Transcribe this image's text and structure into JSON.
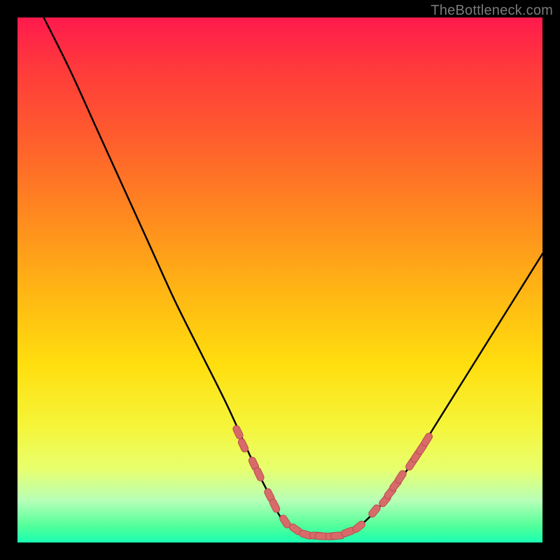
{
  "watermark": "TheBottleneck.com",
  "colors": {
    "background": "#000000",
    "gradient_top": "#ff1a4d",
    "gradient_bottom": "#19ffb2",
    "curve": "#000000",
    "marker_fill": "#d86a6a",
    "marker_stroke": "#b84f4f"
  },
  "chart_data": {
    "type": "line",
    "title": "",
    "xlabel": "",
    "ylabel": "",
    "xlim": [
      0,
      100
    ],
    "ylim": [
      0,
      100
    ],
    "series": [
      {
        "name": "curve",
        "x": [
          5,
          10,
          15,
          20,
          25,
          30,
          35,
          40,
          45,
          48,
          50,
          52,
          55,
          58,
          60,
          62,
          65,
          70,
          75,
          80,
          85,
          90,
          95,
          100
        ],
        "y": [
          100,
          90,
          79,
          68,
          57,
          46,
          36,
          26,
          15,
          9,
          5,
          3,
          1.5,
          1.2,
          1.2,
          1.5,
          3,
          8,
          15,
          23,
          31,
          39,
          47,
          55
        ]
      }
    ],
    "markers": [
      {
        "x": 42,
        "y": 21.0
      },
      {
        "x": 43,
        "y": 18.5
      },
      {
        "x": 45,
        "y": 15.0
      },
      {
        "x": 46,
        "y": 13.0
      },
      {
        "x": 48,
        "y": 9.0
      },
      {
        "x": 49,
        "y": 7.0
      },
      {
        "x": 51,
        "y": 4.0
      },
      {
        "x": 53,
        "y": 2.5
      },
      {
        "x": 55,
        "y": 1.5
      },
      {
        "x": 57,
        "y": 1.3
      },
      {
        "x": 58,
        "y": 1.2
      },
      {
        "x": 60,
        "y": 1.2
      },
      {
        "x": 61,
        "y": 1.3
      },
      {
        "x": 63,
        "y": 2.0
      },
      {
        "x": 65,
        "y": 3.0
      },
      {
        "x": 68,
        "y": 6.0
      },
      {
        "x": 70,
        "y": 8.0
      },
      {
        "x": 71,
        "y": 9.5
      },
      {
        "x": 72,
        "y": 11.0
      },
      {
        "x": 73,
        "y": 12.5
      },
      {
        "x": 75,
        "y": 15.0
      },
      {
        "x": 76,
        "y": 16.5
      },
      {
        "x": 77,
        "y": 18.0
      },
      {
        "x": 78,
        "y": 19.6
      }
    ]
  }
}
